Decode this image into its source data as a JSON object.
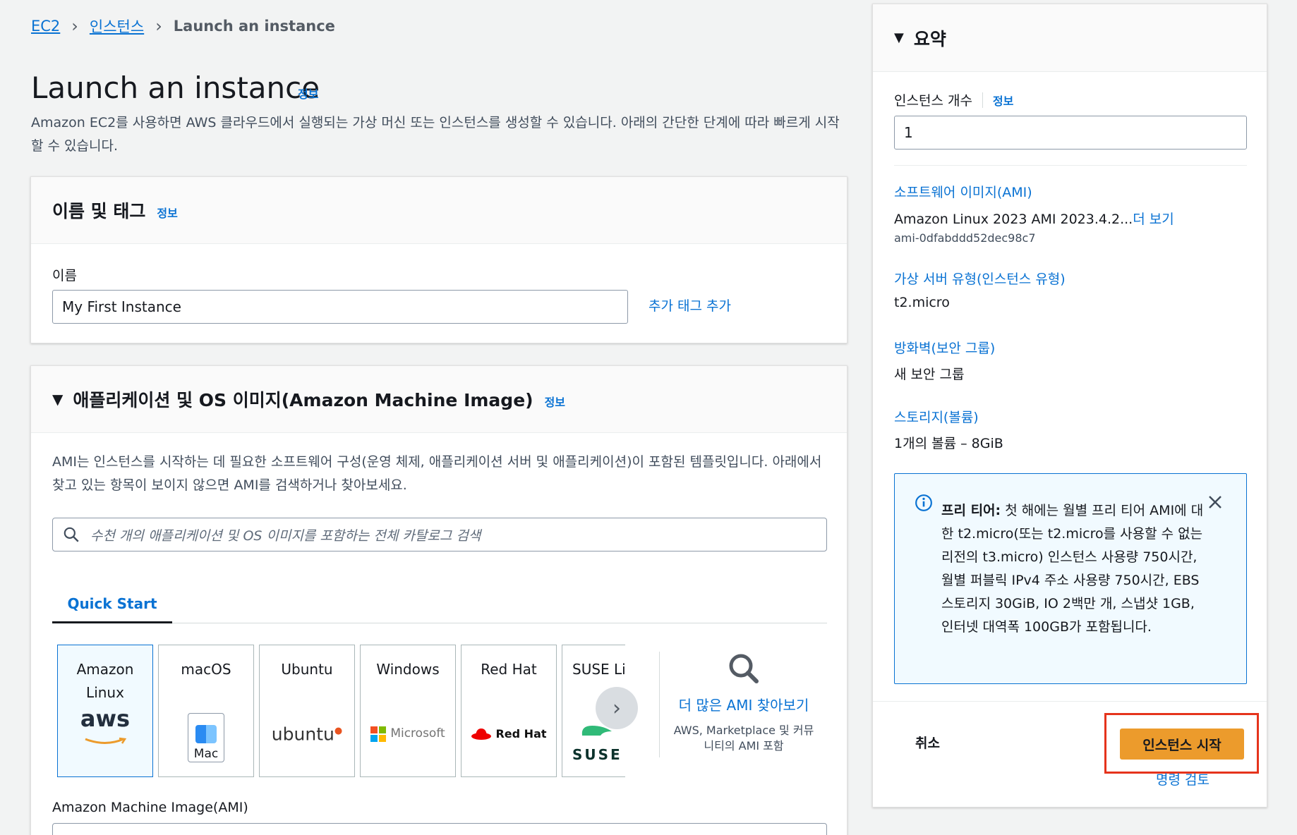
{
  "colors": {
    "accent": "#0972d3",
    "launch": "#ec9b2c",
    "highlight": "#e5341c"
  },
  "breadcrumb": [
    {
      "label": "EC2"
    },
    {
      "label": "인스턴스"
    },
    {
      "label": "Launch an instance"
    }
  ],
  "page": {
    "title": "Launch an instance",
    "info": "정보",
    "description": "Amazon EC2를 사용하면 AWS 클라우드에서 실행되는 가상 머신 또는 인스턴스를 생성할 수 있습니다. 아래의 간단한 단계에 따라 빠르게 시작할 수 있습니다."
  },
  "name_tags": {
    "title": "이름 및 태그",
    "info": "정보",
    "name_label": "이름",
    "name_value": "My First Instance",
    "add_tags": "추가 태그 추가"
  },
  "ami": {
    "title": "애플리케이션 및 OS 이미지(Amazon Machine Image)",
    "info": "정보",
    "description": "AMI는 인스턴스를 시작하는 데 필요한 소프트웨어 구성(운영 체제, 애플리케이션 서버 및 애플리케이션)이 포함된 템플릿입니다. 아래에서 찾고 있는 항목이 보이지 않으면 AMI를 검색하거나 찾아보세요.",
    "search_placeholder": "수천 개의 애플리케이션 및 OS 이미지를 포함하는 전체 카탈로그 검색",
    "tab": "Quick Start",
    "tiles": [
      {
        "label": "Amazon Linux",
        "logo": "aws"
      },
      {
        "label": "macOS",
        "logo": "Mac"
      },
      {
        "label": "Ubuntu",
        "logo": "ubuntu"
      },
      {
        "label": "Windows",
        "logo": "Microsoft"
      },
      {
        "label": "Red Hat",
        "logo": "Red Hat"
      },
      {
        "label": "SUSE Li",
        "logo": "SUSE"
      }
    ],
    "browse_more": "더 많은 AMI 찾아보기",
    "browse_sub": "AWS, Marketplace 및 커뮤니티의 AMI 포함",
    "ami_label": "Amazon Machine Image(AMI)"
  },
  "summary": {
    "title": "요약",
    "count_label": "인스턴스 개수",
    "count_info": "정보",
    "count_value": "1",
    "software_label": "소프트웨어 이미지(AMI)",
    "software_value": "Amazon Linux 2023 AMI 2023.4.2...",
    "software_more": "더 보기",
    "software_id": "ami-0dfabddd52dec98c7",
    "type_label": "가상 서버 유형(인스턴스 유형)",
    "type_value": "t2.micro",
    "firewall_label": "방화벽(보안 그룹)",
    "firewall_value": "새 보안 그룹",
    "storage_label": "스토리지(볼륨)",
    "storage_value": "1개의 볼륨 – 8GiB",
    "free_tier_title": "프리 티어:",
    "free_tier_text": "첫 해에는 월별 프리 티어 AMI에 대한 t2.micro(또는 t2.micro를 사용할 수 없는 리전의 t3.micro) 인스턴스 사용량 750시간, 월별 퍼블릭 IPv4 주소 사용량 750시간, EBS 스토리지 30GiB, IO 2백만 개, 스냅샷 1GB, 인터넷 대역폭 100GB가 포함됩니다.",
    "cancel": "취소",
    "launch": "인스턴스 시작",
    "review": "명령 검토"
  }
}
